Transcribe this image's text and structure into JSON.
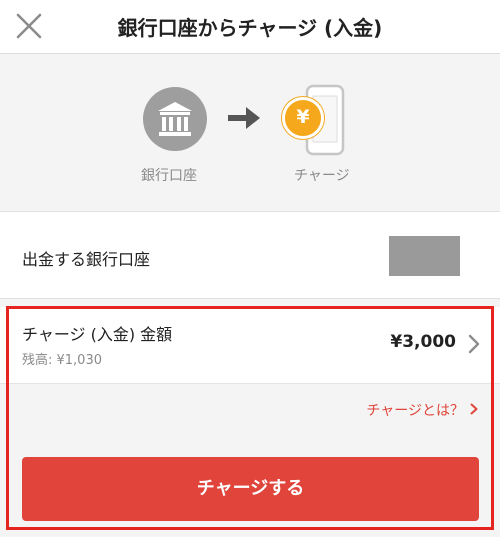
{
  "header": {
    "title": "銀行口座からチャージ (入金)"
  },
  "flow": {
    "from_label": "銀行口座",
    "to_label": "チャージ",
    "currency_symbol": "¥"
  },
  "bank_row": {
    "label": "出金する銀行口座"
  },
  "amount": {
    "title": "チャージ (入金) 金額",
    "balance": "残高: ¥1,030",
    "value": "¥3,000"
  },
  "help_link": {
    "label": "チャージとは？"
  },
  "charge_button": {
    "label": "チャージする"
  },
  "colors": {
    "accent": "#e0443b",
    "coin": "#f5a81c",
    "highlight": "#e52420"
  }
}
